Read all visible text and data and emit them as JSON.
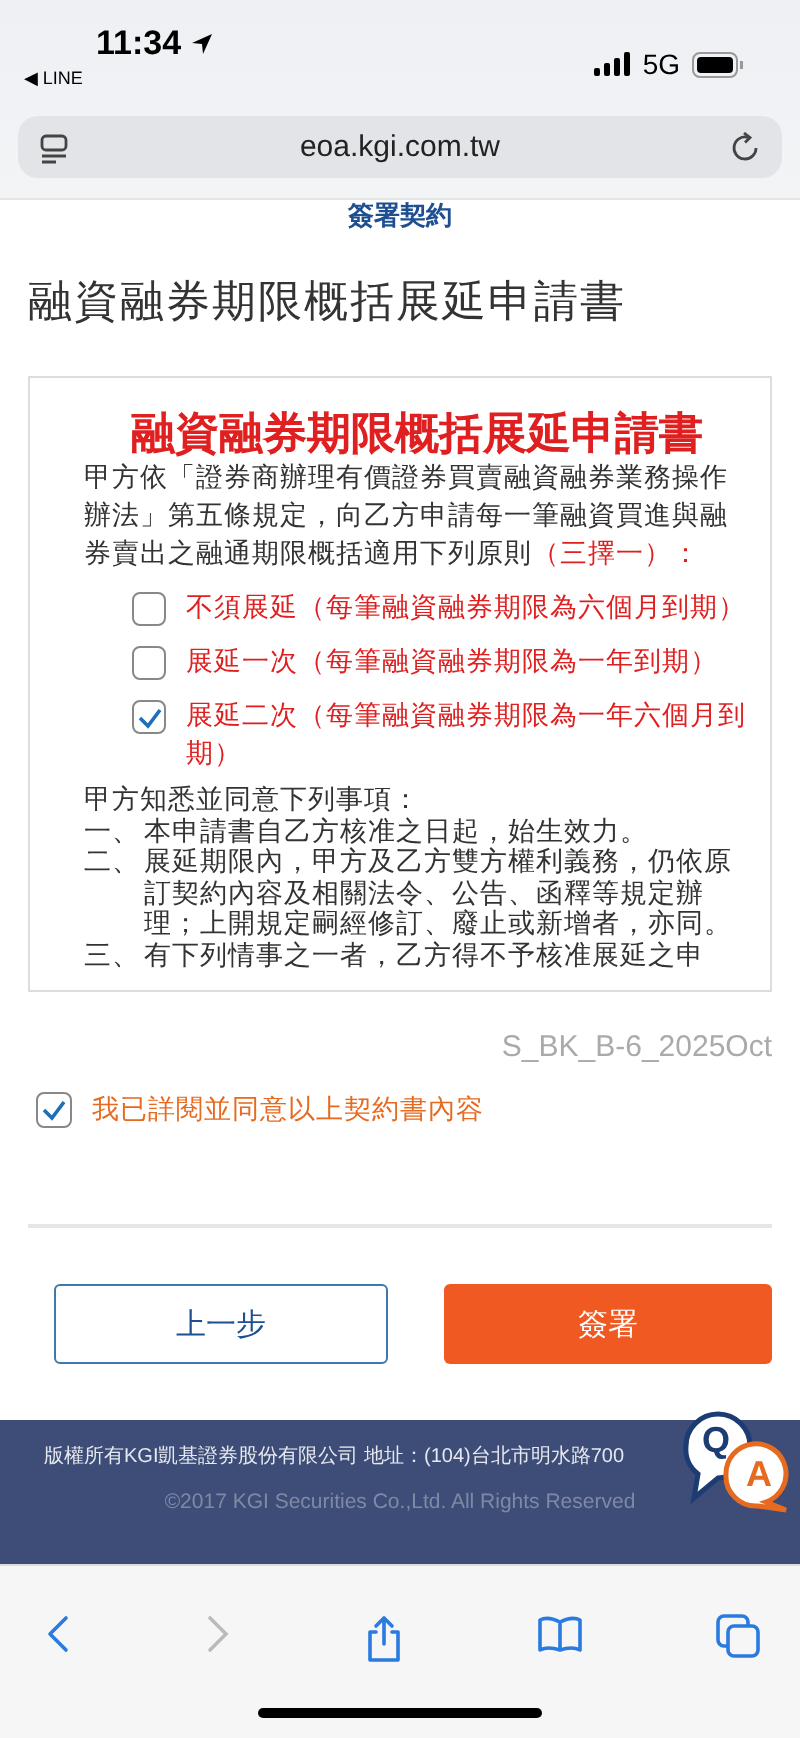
{
  "status_bar": {
    "time": "11:34",
    "back_app": "◀ LINE",
    "network": "5G"
  },
  "url_bar": {
    "url": "eoa.kgi.com.tw"
  },
  "page_header": "簽署契約",
  "page_title": "融資融券期限概括展延申請書",
  "contract": {
    "title": "融資融券期限概括展延申請書",
    "intro": "甲方依「證券商辦理有價證券買賣融資融券業務操作辦法」第五條規定，向乙方申請每一筆融資買進與融券賣出之融通期限概括適用下列原則",
    "intro_note": "（三擇一）：",
    "options": [
      {
        "label": "不須展延（每筆融資融券期限為六個月到期）",
        "selected": false
      },
      {
        "label": "展延一次（每筆融資融券期限為一年到期）",
        "selected": false
      },
      {
        "label": "展延二次（每筆融資融券期限為一年六個月到期）",
        "selected": true
      }
    ],
    "terms_heading": "甲方知悉並同意下列事項：",
    "terms": [
      {
        "marker": "一、",
        "text": "本申請書自乙方核准之日起，始生效力。"
      },
      {
        "marker": "二、",
        "text": "展延期限內，甲方及乙方雙方權利義務，仍依原訂契約內容及相關法令、公告、函釋等規定辦理；上開規定嗣經修訂、廢止或新增者，亦同。"
      },
      {
        "marker": "三、",
        "text": "有下列情事之一者，乙方得不予核准展延之申"
      }
    ]
  },
  "version": "S_BK_B-6_2025Oct",
  "agree": {
    "label": "我已詳閱並同意以上契約書內容",
    "checked": true
  },
  "buttons": [
    {
      "kind": "secondary",
      "label": "上一步"
    },
    {
      "kind": "primary",
      "label": "簽署"
    }
  ],
  "footer": {
    "company": "版權所有KGI凱基證券股份有限公司 地址：(104)台北市明水路700",
    "copyright": "©2017 KGI Securities Co.,Ltd. All Rights Reserved"
  },
  "qa_widget": {
    "q": "Q",
    "a": "A"
  }
}
